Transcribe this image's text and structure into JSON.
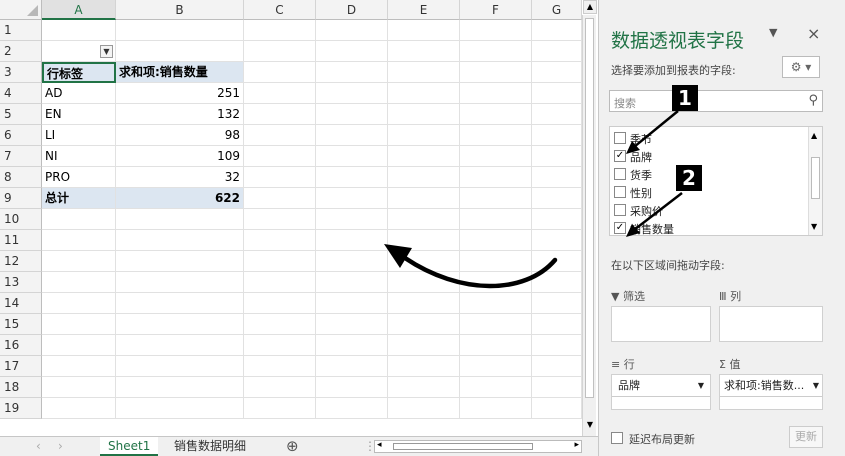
{
  "columns": [
    "A",
    "B",
    "C",
    "D",
    "E",
    "F",
    "G"
  ],
  "rows": [
    "1",
    "2",
    "3",
    "4",
    "5",
    "6",
    "7",
    "8",
    "9",
    "10",
    "11",
    "12",
    "13",
    "14",
    "15",
    "16",
    "17",
    "18",
    "19"
  ],
  "pivot": {
    "header_label": "行标签",
    "header_value": "求和项:销售数量",
    "items": [
      {
        "label": "AD",
        "value": "251"
      },
      {
        "label": "EN",
        "value": "132"
      },
      {
        "label": "LI",
        "value": "98"
      },
      {
        "label": "NI",
        "value": "109"
      },
      {
        "label": "PRO",
        "value": "32"
      }
    ],
    "total_label": "总计",
    "total_value": "622"
  },
  "sheet_tabs": {
    "active": "Sheet1",
    "other": "销售数据明细",
    "add": "⊕"
  },
  "panel": {
    "title": "数据透视表字段",
    "choose_label": "选择要添加到报表的字段:",
    "search_placeholder": "搜索",
    "fields": [
      {
        "name": "季节",
        "checked": false
      },
      {
        "name": "品牌",
        "checked": true
      },
      {
        "name": "货季",
        "checked": false
      },
      {
        "name": "性别",
        "checked": false
      },
      {
        "name": "采购价",
        "checked": false
      },
      {
        "name": "销售数量",
        "checked": true
      }
    ],
    "drag_label": "在以下区域间拖动字段:",
    "filter_label": "筛选",
    "columns_label": "列",
    "rows_label": "行",
    "values_label": "值",
    "rows_value": "品牌",
    "values_value": "求和项:销售数...",
    "defer_label": "延迟布局更新",
    "update_button": "更新"
  },
  "markers": {
    "one": "1",
    "two": "2"
  },
  "colors": {
    "accent": "#217346",
    "pivot_header": "#dce6f1"
  }
}
